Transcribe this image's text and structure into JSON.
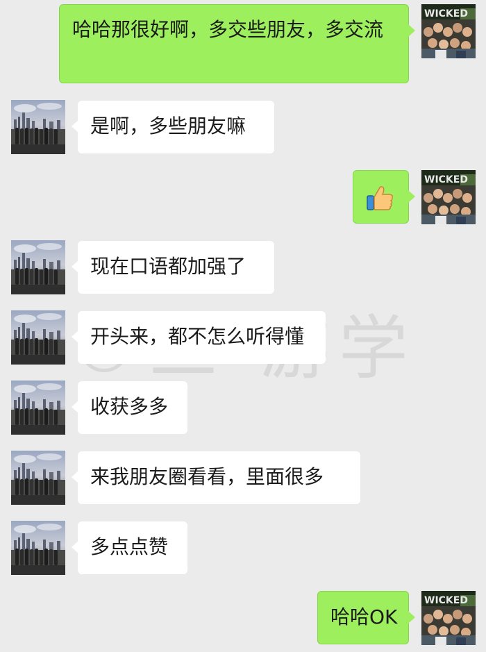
{
  "chat": {
    "messages": [
      {
        "side": "sent",
        "text": "哈哈那很好啊，多交些朋友，多交流"
      },
      {
        "side": "recv",
        "text": "是啊，多些朋友嘛"
      },
      {
        "side": "sent",
        "type": "emoji",
        "emoji": "thumbs-up-icon"
      },
      {
        "side": "recv",
        "text": "现在口语都加强了"
      },
      {
        "side": "recv",
        "text": "开头来，都不怎么听得懂"
      },
      {
        "side": "recv",
        "text": "收获多多"
      },
      {
        "side": "recv",
        "text": "来我朋友圈看看，里面很多"
      },
      {
        "side": "recv",
        "text": "多点点赞"
      },
      {
        "side": "sent",
        "text": "哈哈OK"
      }
    ]
  },
  "avatar_sent": {
    "sign_text": "WICKED"
  },
  "watermark": {
    "text": "©三  游学"
  },
  "colors": {
    "background": "#ebebeb",
    "sent_bubble": "#9def5e",
    "recv_bubble": "#ffffff"
  }
}
